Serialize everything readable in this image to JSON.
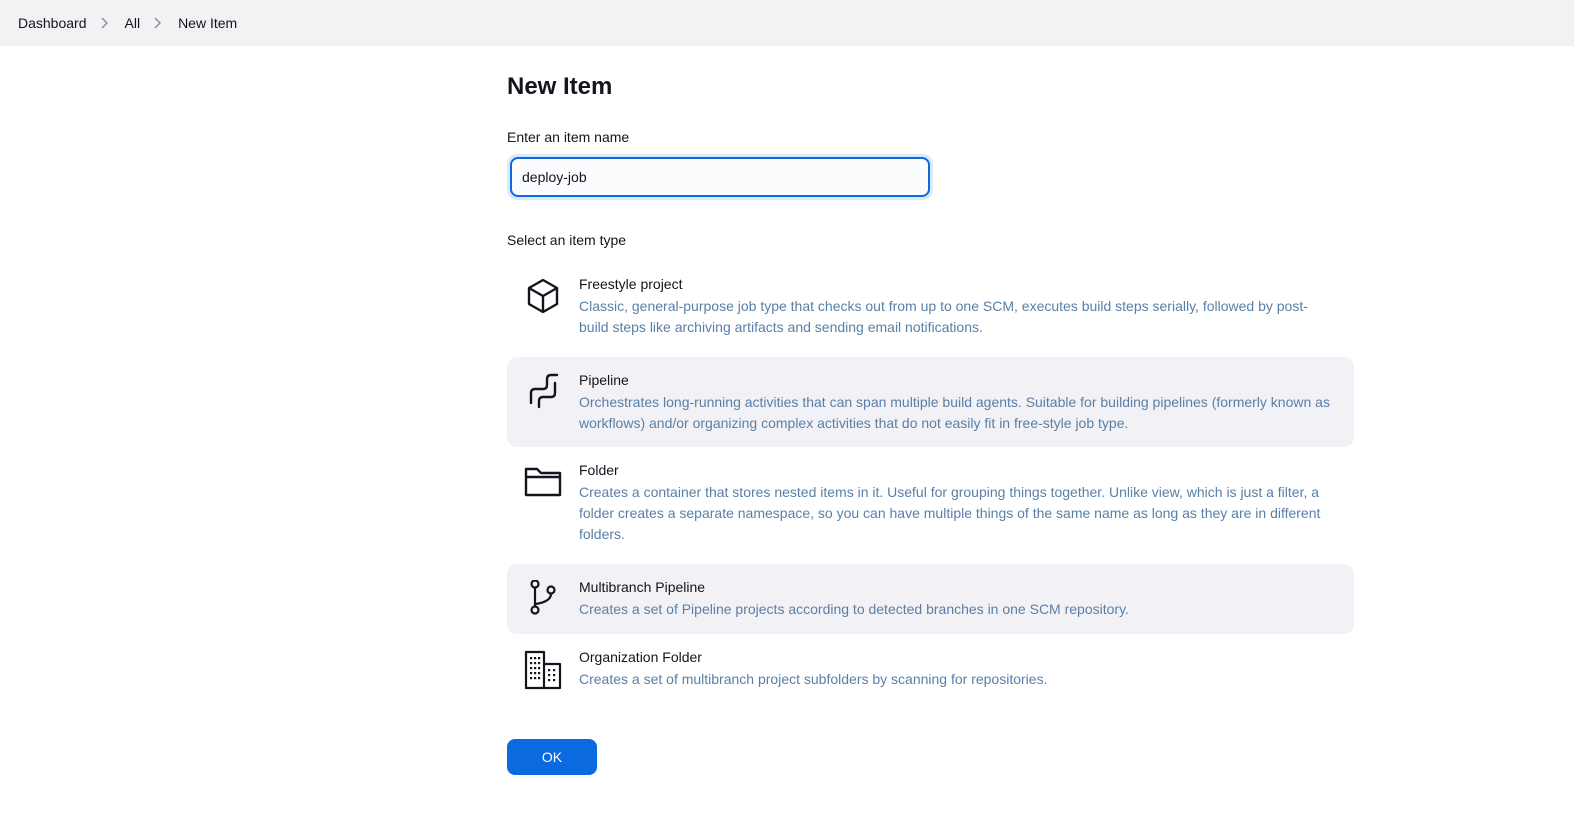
{
  "breadcrumb": {
    "items": [
      "Dashboard",
      "All",
      "New Item"
    ]
  },
  "page": {
    "title": "New Item",
    "name_label": "Enter an item name",
    "name_value": "deploy-job",
    "type_label": "Select an item type"
  },
  "item_types": [
    {
      "icon": "cube-icon",
      "title": "Freestyle project",
      "description": "Classic, general-purpose job type that checks out from up to one SCM, executes build steps serially, followed by post-build steps like archiving artifacts and sending email notifications."
    },
    {
      "icon": "pipeline-icon",
      "title": "Pipeline",
      "description": "Orchestrates long-running activities that can span multiple build agents. Suitable for building pipelines (formerly known as workflows) and/or organizing complex activities that do not easily fit in free-style job type."
    },
    {
      "icon": "folder-icon",
      "title": "Folder",
      "description": "Creates a container that stores nested items in it. Useful for grouping things together. Unlike view, which is just a filter, a folder creates a separate namespace, so you can have multiple things of the same name as long as they are in different folders."
    },
    {
      "icon": "git-branch-icon",
      "title": "Multibranch Pipeline",
      "description": "Creates a set of Pipeline projects according to detected branches in one SCM repository."
    },
    {
      "icon": "building-icon",
      "title": "Organization Folder",
      "description": "Creates a set of multibranch project subfolders by scanning for repositories."
    }
  ],
  "actions": {
    "ok_label": "OK"
  },
  "colors": {
    "accent": "#0b6ae0",
    "description_text": "#5a7fa6",
    "topbar_bg": "#f2f2f4",
    "hover_bg": "#f2f2f6"
  }
}
